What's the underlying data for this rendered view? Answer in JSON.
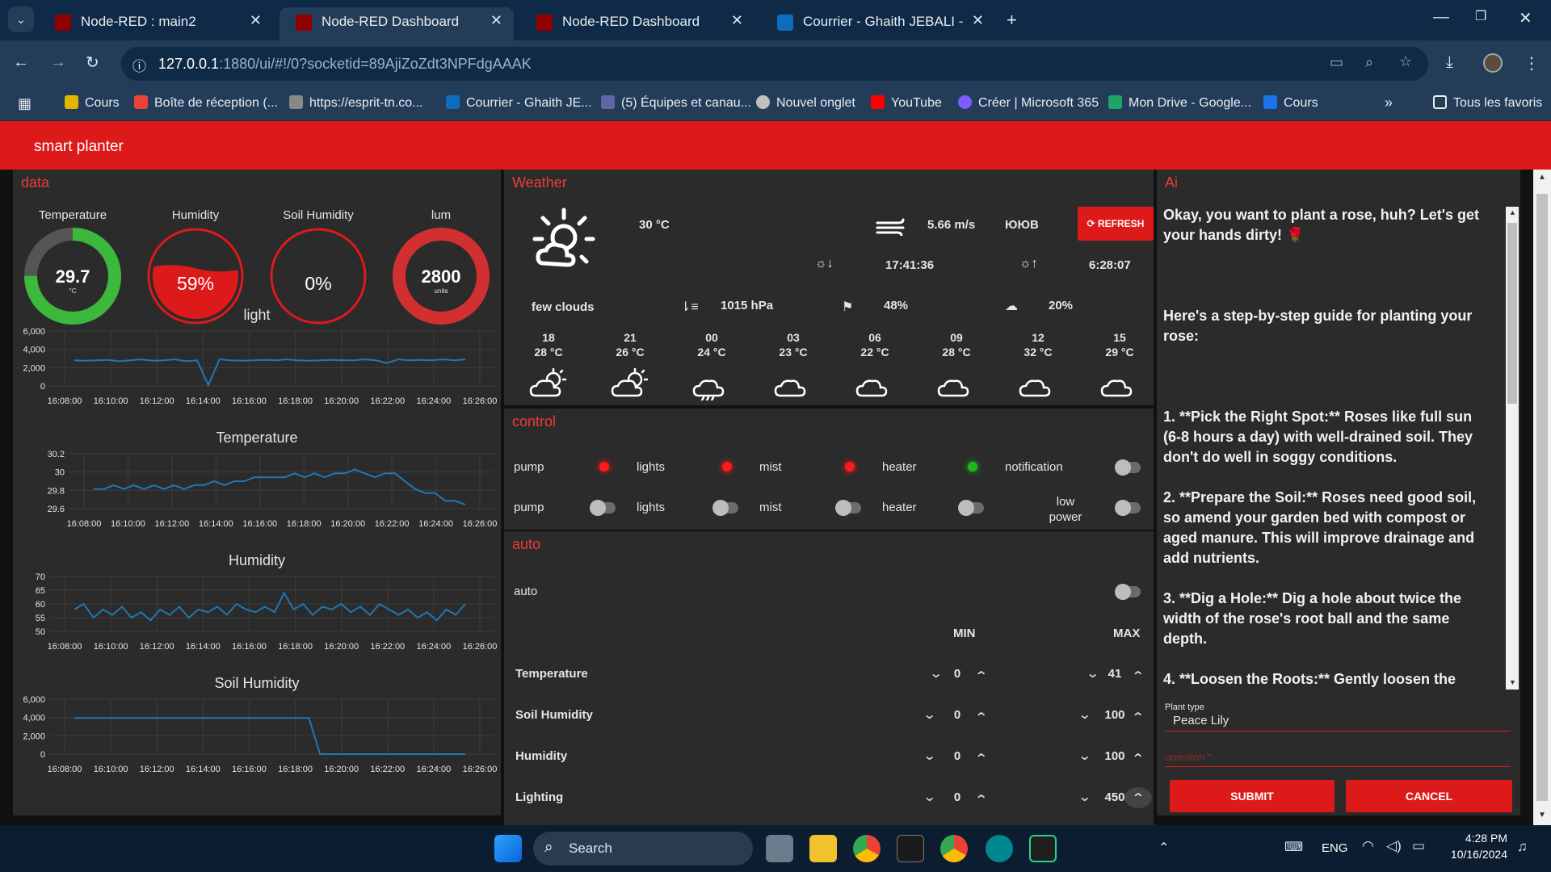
{
  "browser": {
    "tabs": [
      {
        "title": "Node-RED : main2",
        "active": false
      },
      {
        "title": "Node-RED Dashboard",
        "active": true
      },
      {
        "title": "Node-RED Dashboard",
        "active": false
      },
      {
        "title": "Courrier - Ghaith JEBALI - Outlo",
        "active": false
      }
    ],
    "url_host": "127.0.0.1",
    "url_rest": ":1880/ui/#!/0?socketid=89AjiZoZdt3NPFdgAAAK",
    "bookmarks": [
      "Cours",
      "Boîte de réception (...",
      "https://esprit-tn.co...",
      "Courrier - Ghaith JE...",
      "(5) Équipes et canau...",
      "Nouvel onglet",
      "YouTube",
      "Créer | Microsoft 365",
      "Mon Drive - Google...",
      "Cours"
    ],
    "all_favorites": "Tous les favoris"
  },
  "header": {
    "title": "smart planter"
  },
  "data_panel": {
    "title": "data",
    "gauges": [
      {
        "label": "Temperature",
        "value": "29.7",
        "unit": "°C",
        "fraction": 0.75
      },
      {
        "label": "Humidity",
        "value": "59%",
        "unit": "",
        "fraction": 0.59
      },
      {
        "label": "Soil Humidity",
        "value": "0%",
        "unit": "",
        "fraction": 0
      },
      {
        "label": "lum",
        "value": "2800",
        "unit": "units",
        "fraction": 1
      }
    ]
  },
  "chart_data": [
    {
      "type": "line",
      "title": "light",
      "x": [
        "16:08:00",
        "16:10:00",
        "16:12:00",
        "16:14:00",
        "16:16:00",
        "16:18:00",
        "16:20:00",
        "16:22:00",
        "16:24:00",
        "16:26:00"
      ],
      "yticks": [
        "6,000",
        "4,000",
        "2,000",
        "0"
      ],
      "ylim": [
        0,
        6000
      ],
      "series": [
        {
          "values": [
            2800,
            2750,
            2800,
            2850,
            2700,
            2800,
            2900,
            2750,
            2800,
            2900,
            2700,
            2800,
            100,
            2900,
            2800,
            2750,
            2800,
            2850,
            2800,
            2900,
            2800,
            2750,
            2800,
            2850,
            2800,
            2800,
            2900,
            2800,
            2500,
            2900,
            2800,
            2850,
            2800,
            2900,
            2800,
            2900
          ]
        }
      ]
    },
    {
      "type": "line",
      "title": "Temperature",
      "x": [
        "16:08:00",
        "16:10:00",
        "16:12:00",
        "16:14:00",
        "16:16:00",
        "16:18:00",
        "16:20:00",
        "16:22:00",
        "16:24:00",
        "16:26:00"
      ],
      "yticks": [
        "30.2",
        "30",
        "29.8",
        "29.6"
      ],
      "ylim": [
        29.55,
        30.25
      ],
      "series": [
        {
          "values": [
            29.8,
            29.8,
            29.85,
            29.8,
            29.85,
            29.8,
            29.85,
            29.8,
            29.85,
            29.8,
            29.85,
            29.85,
            29.9,
            29.85,
            29.9,
            29.9,
            29.95,
            29.95,
            29.95,
            29.95,
            30.0,
            29.95,
            30.0,
            29.95,
            30.0,
            30.0,
            30.05,
            30.0,
            29.95,
            30.0,
            30.0,
            29.9,
            29.8,
            29.75,
            29.75,
            29.65,
            29.65,
            29.6
          ]
        }
      ]
    },
    {
      "type": "line",
      "title": "Humidity",
      "x": [
        "16:08:00",
        "16:10:00",
        "16:12:00",
        "16:14:00",
        "16:16:00",
        "16:18:00",
        "16:20:00",
        "16:22:00",
        "16:24:00",
        "16:26:00"
      ],
      "yticks": [
        "70",
        "65",
        "60",
        "55",
        "50"
      ],
      "ylim": [
        50,
        70
      ],
      "series": [
        {
          "values": [
            58,
            60,
            55,
            58,
            56,
            59,
            55,
            57,
            54,
            58,
            56,
            59,
            55,
            58,
            57,
            59,
            56,
            60,
            58,
            57,
            59,
            57,
            64,
            58,
            60,
            56,
            59,
            58,
            60,
            57,
            59,
            56,
            60,
            58,
            56,
            58,
            55,
            57,
            54,
            58,
            56,
            60
          ]
        }
      ]
    },
    {
      "type": "line",
      "title": "Soil Humidity",
      "x": [
        "16:08:00",
        "16:10:00",
        "16:12:00",
        "16:14:00",
        "16:16:00",
        "16:18:00",
        "16:20:00",
        "16:22:00",
        "16:24:00",
        "16:26:00"
      ],
      "yticks": [
        "6,000",
        "4,000",
        "2,000",
        "0"
      ],
      "ylim": [
        0,
        6000
      ],
      "series": [
        {
          "values": [
            3950,
            3950,
            3950,
            3950,
            3950,
            3950,
            3950,
            3950,
            3950,
            3950,
            3950,
            3950,
            3950,
            3950,
            3950,
            3950,
            3950,
            3950,
            3950,
            3950,
            3950,
            3950,
            0,
            0,
            0,
            0,
            0,
            0,
            0,
            0,
            0,
            0,
            0,
            0,
            0,
            0
          ]
        }
      ]
    }
  ],
  "weather": {
    "title": "Weather",
    "temp": "30 °C",
    "wind": "5.66 m/s",
    "direction": "ЮЮВ",
    "refresh": "REFRESH",
    "sunset": "17:41:36",
    "sunrise": "6:28:07",
    "description": "few clouds",
    "pressure": "1015 hPa",
    "humidity": "48%",
    "clouds": "20%",
    "forecast": [
      {
        "hour": "18",
        "temp": "28 °C",
        "icon": "partly-sunny-icon"
      },
      {
        "hour": "21",
        "temp": "26 °C",
        "icon": "partly-sunny-icon"
      },
      {
        "hour": "00",
        "temp": "24 °C",
        "icon": "rain-icon"
      },
      {
        "hour": "03",
        "temp": "23 °C",
        "icon": "cloud-icon"
      },
      {
        "hour": "06",
        "temp": "22 °C",
        "icon": "cloud-icon"
      },
      {
        "hour": "09",
        "temp": "28 °C",
        "icon": "cloud-icon"
      },
      {
        "hour": "12",
        "temp": "32 °C",
        "icon": "cloud-icon"
      },
      {
        "hour": "15",
        "temp": "29 °C",
        "icon": "cloud-icon"
      }
    ]
  },
  "control": {
    "title": "control",
    "status": [
      {
        "label": "pump",
        "color": "#ff1a1a"
      },
      {
        "label": "lights",
        "color": "#ff1a1a"
      },
      {
        "label": "mist",
        "color": "#ff1a1a"
      },
      {
        "label": "heater",
        "color": "#1db81d"
      },
      {
        "label": "notification",
        "color": ""
      }
    ],
    "toggles": [
      "pump",
      "lights",
      "mist",
      "heater",
      "low power"
    ]
  },
  "auto": {
    "title": "auto",
    "auto_label": "auto",
    "min_label": "MIN",
    "max_label": "MAX",
    "rows": [
      {
        "label": "Temperature",
        "min": "0",
        "max": "41"
      },
      {
        "label": "Soil Humidity",
        "min": "0",
        "max": "100"
      },
      {
        "label": "Humidity",
        "min": "0",
        "max": "100"
      },
      {
        "label": "Lighting",
        "min": "0",
        "max": "450"
      }
    ]
  },
  "ai": {
    "title": "Ai",
    "paragraphs": [
      "Okay, you want to plant a rose, huh? Let's get your hands dirty! 🌹",
      "Here's a step-by-step guide for planting your rose:",
      "1. **Pick the Right Spot:** Roses like full sun (6-8 hours a day) with well-drained soil. They don't do well in soggy conditions.",
      "2. **Prepare the Soil:** Roses need good soil, so amend your garden bed with compost or aged manure. This will improve drainage and add nutrients.",
      "3. **Dig a Hole:** Dig a hole about twice the width of the rose's root ball and the same depth.",
      "4. **Loosen the Roots:** Gently loosen the"
    ],
    "plant_type_label": "Plant type",
    "plant_type_value": "Peace Lily",
    "question_placeholder": "question *",
    "submit": "SUBMIT",
    "cancel": "CANCEL"
  },
  "taskbar": {
    "search": "Search",
    "lang": "ENG",
    "time": "4:28 PM",
    "date": "10/16/2024"
  }
}
